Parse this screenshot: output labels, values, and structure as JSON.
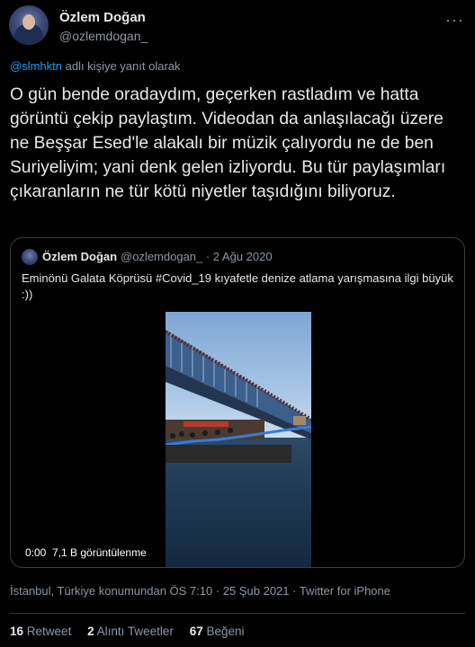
{
  "author": {
    "name": "Özlem Doğan",
    "handle": "@ozlemdogan_"
  },
  "reply_to": {
    "mention": "@slmhktn",
    "suffix": " adlı kişiye yanıt olarak"
  },
  "tweet_text": "O gün bende oradaydım, geçerken rastladım ve hatta görüntü çekip paylaştım. Videodan da anlaşılacağı üzere ne Beşşar Esed'le alakalı bir müzik çalıyordu ne de ben Suriyeliyim; yani denk gelen izliyordu. Bu tür paylaşımları çıkaranların ne tür kötü niyetler taşıdığını biliyoruz.",
  "quoted": {
    "name": "Özlem Doğan",
    "handle_date": "@ozlemdogan_ · 2 Ağu 2020",
    "text": "Eminönü Galata Köprüsü #Covid_19 kıyafetle denize atlama yarışmasına ilgi büyük :))",
    "video": {
      "time": "0:00",
      "views": "7,1 B görüntülenme"
    }
  },
  "meta": "İstanbul, Türkiye konumundan ÖS 7:10 · 25 Şub 2021 · Twitter for iPhone",
  "stats": {
    "retweets_count": "16",
    "retweets_label": "Retweet",
    "quotes_count": "2",
    "quotes_label": "Alıntı Tweetler",
    "likes_count": "67",
    "likes_label": "Beğeni"
  },
  "colors": {
    "background": "#000000",
    "link": "#1d9bf0",
    "muted": "#8b98a5",
    "text": "#e7e9ea"
  }
}
